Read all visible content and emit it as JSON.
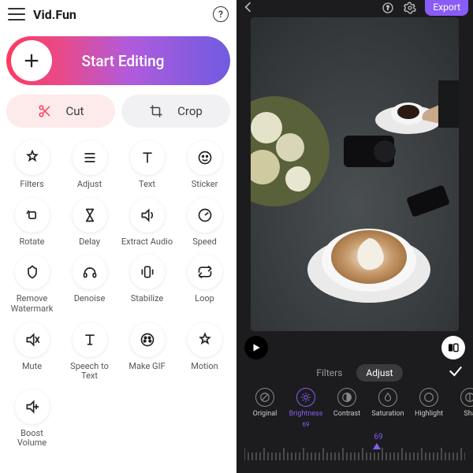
{
  "brand": "Vid.Fun",
  "start_label": "Start Editing",
  "cut_label": "Cut",
  "crop_label": "Crop",
  "tools": [
    {
      "id": "filters",
      "label": "Filters"
    },
    {
      "id": "adjust",
      "label": "Adjust"
    },
    {
      "id": "text",
      "label": "Text"
    },
    {
      "id": "sticker",
      "label": "Sticker"
    },
    {
      "id": "rotate",
      "label": "Rotate"
    },
    {
      "id": "delay",
      "label": "Delay"
    },
    {
      "id": "extract-audio",
      "label": "Extract Audio"
    },
    {
      "id": "speed",
      "label": "Speed"
    },
    {
      "id": "remove-watermark",
      "label": "Remove Watermark"
    },
    {
      "id": "denoise",
      "label": "Denoise"
    },
    {
      "id": "stabilize",
      "label": "Stabilize"
    },
    {
      "id": "loop",
      "label": "Loop"
    },
    {
      "id": "mute",
      "label": "Mute"
    },
    {
      "id": "speech-to-text",
      "label": "Speech to Text"
    },
    {
      "id": "make-gif",
      "label": "Make GIF"
    },
    {
      "id": "motion",
      "label": "Motion"
    },
    {
      "id": "boost-volume",
      "label": "Boost Volume"
    }
  ],
  "export_label": "Export",
  "editor_tabs": {
    "filters": "Filters",
    "adjust": "Adjust"
  },
  "adjust_options": [
    {
      "id": "original",
      "label": "Original"
    },
    {
      "id": "brightness",
      "label": "Brightness",
      "value": "69",
      "active": true
    },
    {
      "id": "contrast",
      "label": "Contrast"
    },
    {
      "id": "saturation",
      "label": "Saturation"
    },
    {
      "id": "highlight",
      "label": "Highlight"
    },
    {
      "id": "shadow",
      "label": "Sha"
    }
  ],
  "slider_value": "69",
  "colors": {
    "accent": "#8a5cf6",
    "gradient_start": "#ff3a5f",
    "gradient_end": "#6f5be0"
  }
}
